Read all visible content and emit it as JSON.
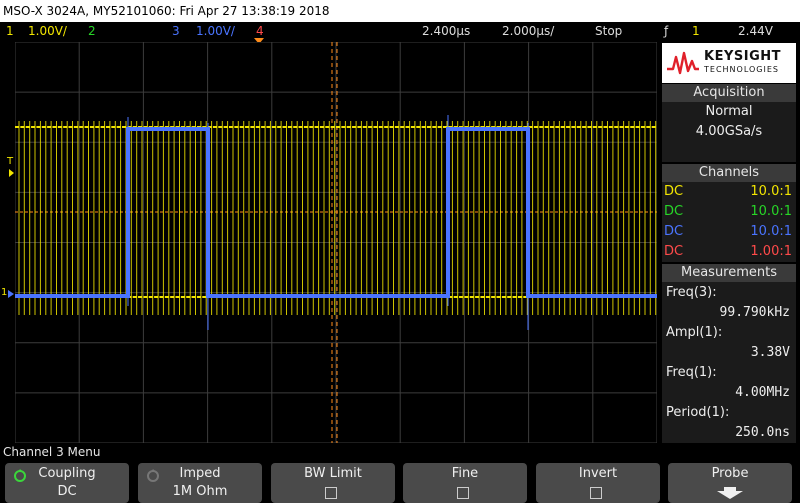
{
  "title_bar": "MSO-X 3024A, MY52101060: Fri Apr 27 13:38:19 2018",
  "status": {
    "ch1_num": "1",
    "ch1_scale": "1.00V/",
    "ch2_num": "2",
    "ch3_num": "3",
    "ch3_scale": "1.00V/",
    "ch4_num": "4",
    "time_delay": "2.400μs",
    "time_scale": "2.000μs/",
    "run_state": "Stop",
    "trigger_icon": "ƒ",
    "trigger_source": "1",
    "trigger_level": "2.44V"
  },
  "colors": {
    "ch1": "#f2e600",
    "ch2": "#27d627",
    "ch3": "#4a74ff",
    "ch4": "#ff4a4a",
    "trigger_marker": "#ff8c1a",
    "grid": "#3c3c3c",
    "panel_head": "#3a3a3a",
    "softkey": "#4a4a4a"
  },
  "logo": {
    "line1": "KEYSIGHT",
    "line2": "TECHNOLOGIES"
  },
  "acquisition": {
    "header": "Acquisition",
    "mode": "Normal",
    "rate": "4.00GSa/s"
  },
  "channels": {
    "header": "Channels",
    "rows": [
      {
        "coupling": "DC",
        "ratio": "10.0:1"
      },
      {
        "coupling": "DC",
        "ratio": "10.0:1"
      },
      {
        "coupling": "DC",
        "ratio": "10.0:1"
      },
      {
        "coupling": "DC",
        "ratio": "1.00:1"
      }
    ]
  },
  "measurements": {
    "header": "Measurements",
    "items": [
      {
        "label": "Freq(3):",
        "value": "99.790kHz"
      },
      {
        "label": "Ampl(1):",
        "value": "3.38V"
      },
      {
        "label": "Freq(1):",
        "value": "4.00MHz"
      },
      {
        "label": "Period(1):",
        "value": "250.0ns"
      }
    ]
  },
  "markers": {
    "trigger_T": "T",
    "ch_ground": "1",
    "ch_ground_arrow": "▸"
  },
  "menu_title": "Channel 3 Menu",
  "softkeys": {
    "coupling_label": "Coupling",
    "coupling_value": "DC",
    "imped_label": "Imped",
    "imped_value": "1M Ohm",
    "bwlimit_label": "BW Limit",
    "fine_label": "Fine",
    "invert_label": "Invert",
    "probe_label": "Probe"
  }
}
